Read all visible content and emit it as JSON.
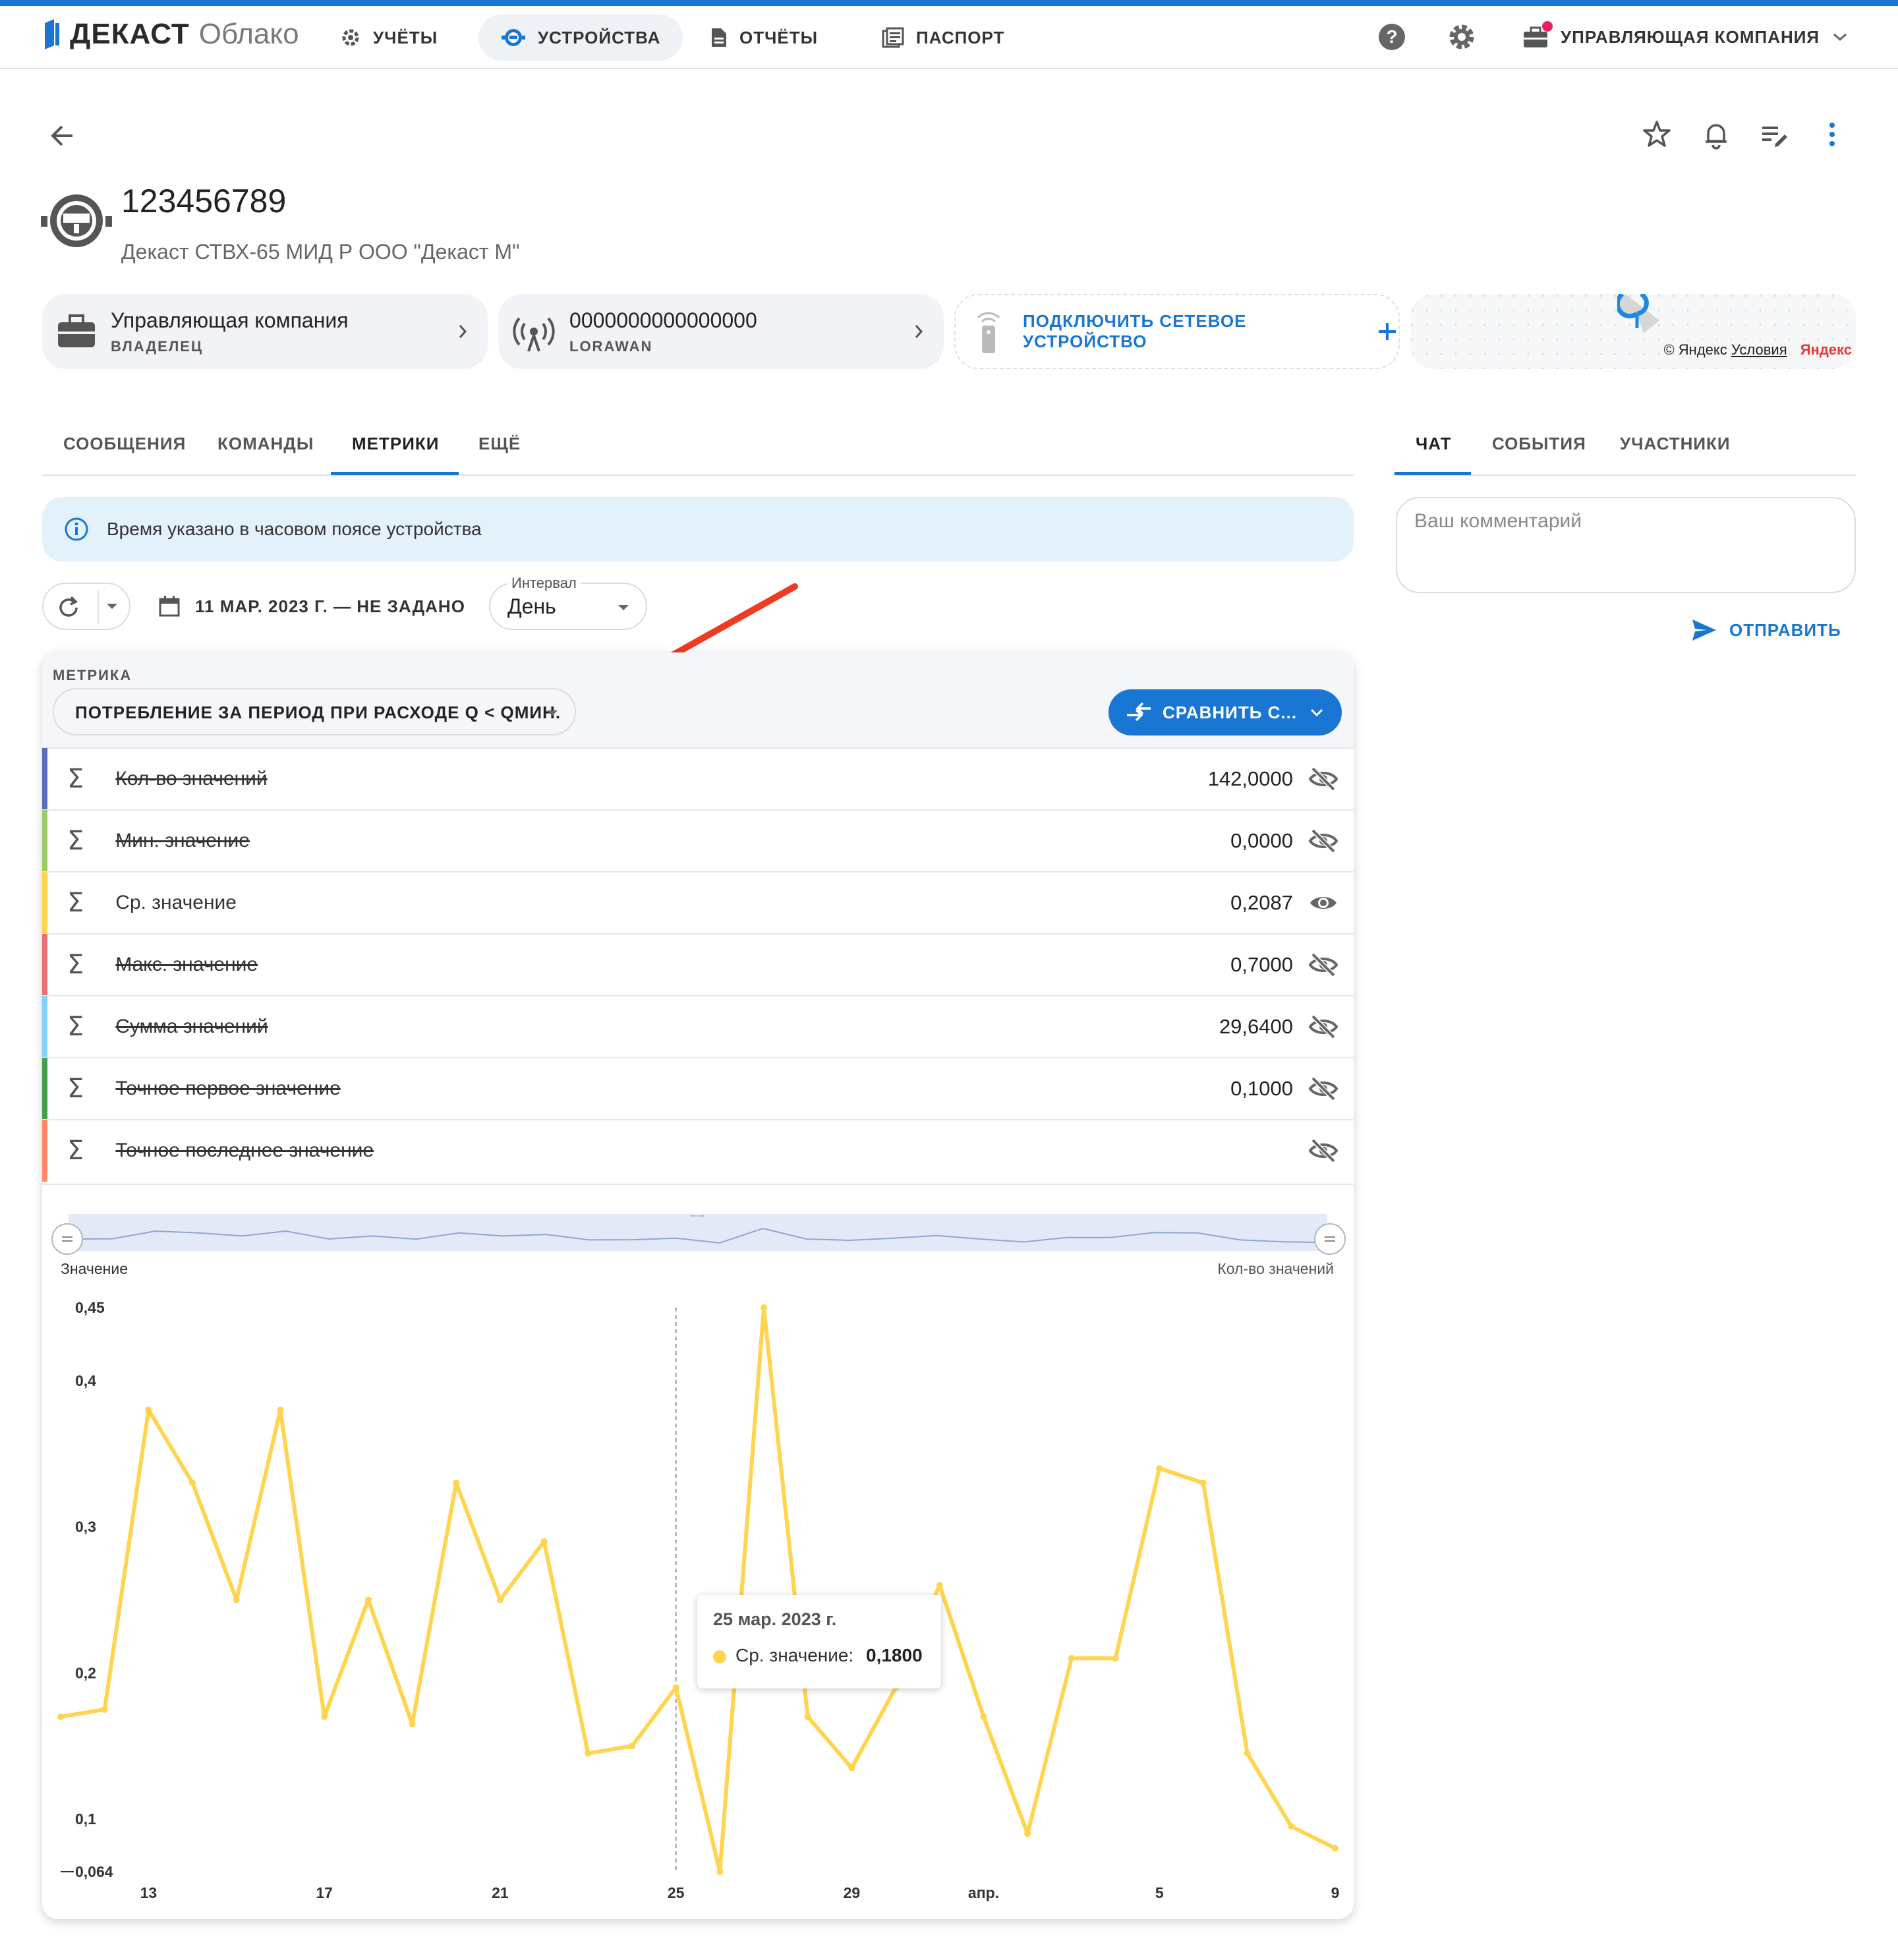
{
  "app": {
    "brand": "ДЕКАСТ",
    "brand_sub": "Облако",
    "nav": [
      {
        "label": "УЧЁТЫ",
        "icon": "settings-outline-icon"
      },
      {
        "label": "УСТРОЙСТВА",
        "icon": "meter-icon"
      },
      {
        "label": "ОТЧЁТЫ",
        "icon": "document-icon"
      },
      {
        "label": "ПАСПОРТ",
        "icon": "passport-icon"
      }
    ],
    "company": "УПРАВЛЯЮЩАЯ КОМПАНИЯ"
  },
  "device": {
    "number": "123456789",
    "model": "Декаст СТВХ-65 МИД Р ООО \"Декаст М\""
  },
  "cards": {
    "owner_title": "Управляющая компания",
    "owner_sub": "ВЛАДЕЛЕЦ",
    "net_title": "0000000000000000",
    "net_sub": "LORAWAN",
    "connect": "ПОДКЛЮЧИТЬ СЕТЕВОЕ УСТРОЙСТВО",
    "map_copy": "© Яндекс",
    "map_terms": "Условия",
    "map_brand": "Яндекс"
  },
  "tabs": [
    "СООБЩЕНИЯ",
    "КОМАНДЫ",
    "МЕТРИКИ",
    "ЕЩЁ"
  ],
  "side_tabs": [
    "ЧАТ",
    "СОБЫТИЯ",
    "УЧАСТНИКИ"
  ],
  "info": "Время указано в часовом поясе устройства",
  "filters": {
    "date_range": "11 МАР. 2023 Г. — НЕ ЗАДАНО",
    "interval_label": "Интервал",
    "interval_value": "День"
  },
  "metric": {
    "label": "МЕТРИКА",
    "value": "ПОТРЕБЛЕНИЕ ЗА ПЕРИОД ПРИ РАСХОДЕ Q < QМИН.",
    "compare": "СРАВНИТЬ С..."
  },
  "rows": [
    {
      "label": "Кол-во значений",
      "value": "142,0000",
      "visible": false,
      "color": "#5c6bc0"
    },
    {
      "label": "Мин. значение",
      "value": "0,0000",
      "visible": false,
      "color": "#9ccc65"
    },
    {
      "label": "Ср. значение",
      "value": "0,2087",
      "visible": true,
      "color": "#ffd54f"
    },
    {
      "label": "Макс. значение",
      "value": "0,7000",
      "visible": false,
      "color": "#e57373"
    },
    {
      "label": "Сумма значений",
      "value": "29,6400",
      "visible": false,
      "color": "#81d4fa"
    },
    {
      "label": "Точное первое значение",
      "value": "0,1000",
      "visible": false,
      "color": "#43a047"
    },
    {
      "label": "Точное последнее значение",
      "value": "",
      "visible": false,
      "color": "#ff8a65"
    }
  ],
  "chat": {
    "placeholder": "Ваш комментарий",
    "send": "ОТПРАВИТЬ"
  },
  "tooltip": {
    "date": "25 мар. 2023 г.",
    "series": "Ср. значение:",
    "value": "0,1800"
  },
  "chart_data": {
    "type": "line",
    "ylabel": "Значение",
    "y2label": "Кол-во значений",
    "ylim": [
      0.064,
      0.45
    ],
    "y_ticks": [
      "0,064",
      "0,1",
      "0,2",
      "0,3",
      "0,4",
      "0,45"
    ],
    "y_tick_values": [
      0.064,
      0.1,
      0.2,
      0.3,
      0.4,
      0.45
    ],
    "x_ticks": [
      "13",
      "17",
      "21",
      "25",
      "29",
      "апр.",
      "5",
      "9"
    ],
    "x_tick_day": [
      2,
      6,
      10,
      14,
      18,
      21,
      25,
      29
    ],
    "grid": false,
    "series": [
      {
        "name": "Ср. значение",
        "color": "#ffd54f",
        "x_start": "11 мар. 2023",
        "values": [
          0.17,
          0.175,
          0.38,
          0.33,
          0.25,
          0.38,
          0.17,
          0.25,
          0.165,
          0.33,
          0.25,
          0.29,
          0.145,
          0.15,
          0.19,
          0.064,
          0.45,
          0.17,
          0.135,
          0.19,
          0.26,
          0.17,
          0.09,
          0.21,
          0.21,
          0.34,
          0.33,
          0.145,
          0.095,
          0.08
        ]
      }
    ]
  }
}
